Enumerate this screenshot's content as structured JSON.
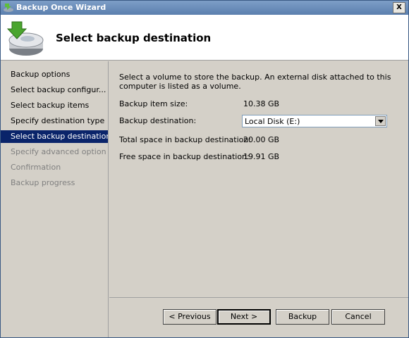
{
  "window": {
    "title": "Backup Once Wizard",
    "close_glyph": "X"
  },
  "header": {
    "title": "Select backup destination"
  },
  "steps": [
    {
      "label": "Backup options",
      "state": "enabled"
    },
    {
      "label": "Select backup configur...",
      "state": "enabled"
    },
    {
      "label": "Select backup items",
      "state": "enabled"
    },
    {
      "label": "Specify destination type",
      "state": "enabled"
    },
    {
      "label": "Select backup destination",
      "state": "active"
    },
    {
      "label": "Specify advanced option",
      "state": "disabled"
    },
    {
      "label": "Confirmation",
      "state": "disabled"
    },
    {
      "label": "Backup progress",
      "state": "disabled"
    }
  ],
  "main": {
    "description": "Select a volume to store the backup. An external disk attached to this computer is listed as a volume.",
    "backup_item_size_label": "Backup item size:",
    "backup_item_size_value": "10.38 GB",
    "destination_label": "Backup destination:",
    "destination_value": "Local Disk (E:)",
    "total_space_label": "Total space in backup destination:",
    "total_space_value": "20.00 GB",
    "free_space_label": "Free space in backup destination:",
    "free_space_value": "19.91 GB"
  },
  "buttons": {
    "previous": "< Previous",
    "next": "Next >",
    "backup": "Backup",
    "cancel": "Cancel"
  },
  "icons": {
    "app": "backup-wizard-icon",
    "header": "backup-disk-icon",
    "dropdown": "chevron-down-icon"
  }
}
